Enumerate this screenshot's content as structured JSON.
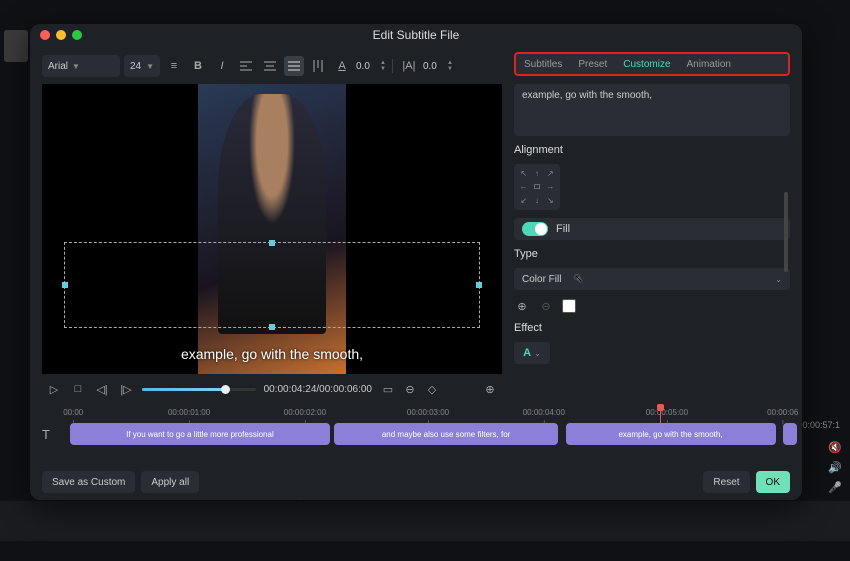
{
  "bg": {
    "time": "00:00:57:1"
  },
  "modal_title": "Edit Subtitle File",
  "font": {
    "family": "Arial",
    "size": "24",
    "spacing": "0.0",
    "line_height": "0.0"
  },
  "tabs": {
    "subtitles": "Subtitles",
    "preset": "Preset",
    "customize": "Customize",
    "animation": "Animation"
  },
  "preview_caption": "example, go with the smooth,",
  "transport": {
    "timecode": "00:00:04:24/00:00:06:00"
  },
  "side": {
    "text_preview": "example, go with the smooth,",
    "alignment_label": "Alignment",
    "fill_label": "Fill",
    "type_label": "Type",
    "type_value": "Color Fill",
    "effect_label": "Effect",
    "effect_char": "A"
  },
  "timeline": {
    "ticks": [
      "00:00",
      "00:00:01:00",
      "00:00:02:00",
      "00:00:03:00",
      "00:00:04:00",
      "00:00:05:00",
      "00:00:06"
    ],
    "clip1": "If you want to go a little more professional",
    "clip2": "and maybe also use some filters, for",
    "clip3": "example, go with the smooth,"
  },
  "footer": {
    "save_custom": "Save as Custom",
    "apply_all": "Apply all",
    "reset": "Reset",
    "ok": "OK"
  }
}
